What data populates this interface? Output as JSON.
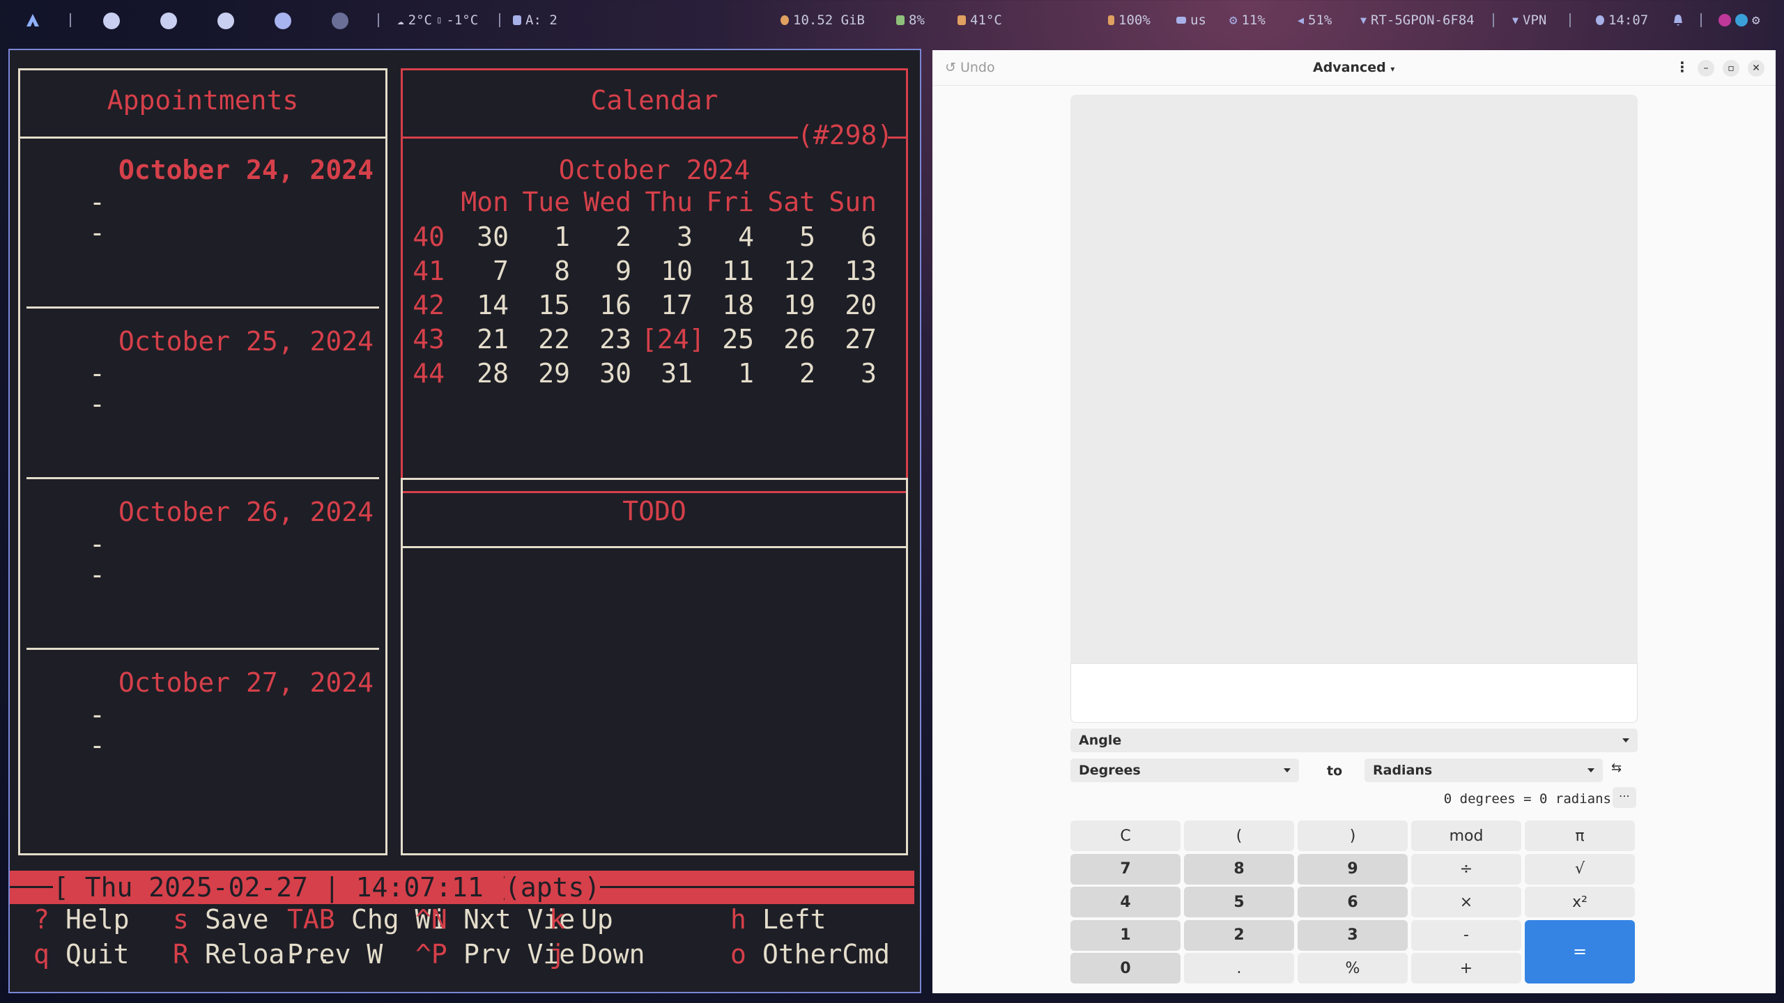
{
  "topbar": {
    "weather": "2°C",
    "feels": "-1°C",
    "apps": "A: 2",
    "memory": "10.52 GiB",
    "cpu_pct": "8%",
    "temp": "41°C",
    "battery": "100%",
    "keyboard": "us",
    "load": "11%",
    "volume": "51%",
    "wifi": "RT-5GPON-6F84",
    "vpn": "VPN",
    "clock": "14:07"
  },
  "terminal": {
    "appointments_title": "Appointments",
    "calendar_title": "Calendar",
    "calendar_tag": "(#298)",
    "month_title": "October 2024",
    "todo_title": "TODO",
    "weekdays": [
      "Mon",
      "Tue",
      "Wed",
      "Thu",
      "Fri",
      "Sat",
      "Sun"
    ],
    "weeks": [
      {
        "wk": "40",
        "days": [
          "30",
          "1",
          "2",
          "3",
          "4",
          "5",
          "6"
        ]
      },
      {
        "wk": "41",
        "days": [
          "7",
          "8",
          "9",
          "10",
          "11",
          "12",
          "13"
        ]
      },
      {
        "wk": "42",
        "days": [
          "14",
          "15",
          "16",
          "17",
          "18",
          "19",
          "20"
        ]
      },
      {
        "wk": "43",
        "days": [
          "21",
          "22",
          "23",
          "[24]",
          "25",
          "26",
          "27"
        ]
      },
      {
        "wk": "44",
        "days": [
          "28",
          "29",
          "30",
          "31",
          "1",
          "2",
          "3"
        ]
      }
    ],
    "appointments": [
      {
        "date": "October 24, 2024",
        "entry": "--"
      },
      {
        "date": "October 25, 2024",
        "entry": "--"
      },
      {
        "date": "October 26, 2024",
        "entry": "--"
      },
      {
        "date": "October 27, 2024",
        "entry": "--"
      }
    ],
    "status_bar": "[ Thu 2025-02-27 | 14:07:11 ]",
    "status_mode": "(apts)",
    "keys_row1": [
      {
        "k": "?",
        "label": "Help"
      },
      {
        "k": "s",
        "label": "Save"
      },
      {
        "k": "TAB",
        "label": "Chg Wi"
      },
      {
        "k": "^N",
        "label": "Nxt Vie"
      },
      {
        "k": "k",
        "label": "Up"
      },
      {
        "k": "h",
        "label": "Left"
      }
    ],
    "keys_row2": [
      {
        "k": "q",
        "label": "Quit"
      },
      {
        "k": "R",
        "label": "Reloa..."
      },
      {
        "k": "",
        "label": "Prev W"
      },
      {
        "k": "^P",
        "label": "Prv Vie"
      },
      {
        "k": "j",
        "label": "Down"
      },
      {
        "k": "o",
        "label": "OtherCmd"
      }
    ]
  },
  "calculator": {
    "undo_label": "Undo",
    "mode_label": "Advanced",
    "conversion_category": "Angle",
    "from_unit": "Degrees",
    "to_label": "to",
    "to_unit": "Radians",
    "result": "0 degrees = 0 radians",
    "buttons": [
      [
        "C",
        "(",
        ")",
        "mod",
        "π"
      ],
      [
        "7",
        "8",
        "9",
        "÷",
        "√"
      ],
      [
        "4",
        "5",
        "6",
        "×",
        "x²"
      ],
      [
        "1",
        "2",
        "3",
        "-",
        "="
      ],
      [
        "0",
        ".",
        "%",
        "+",
        ""
      ]
    ]
  }
}
